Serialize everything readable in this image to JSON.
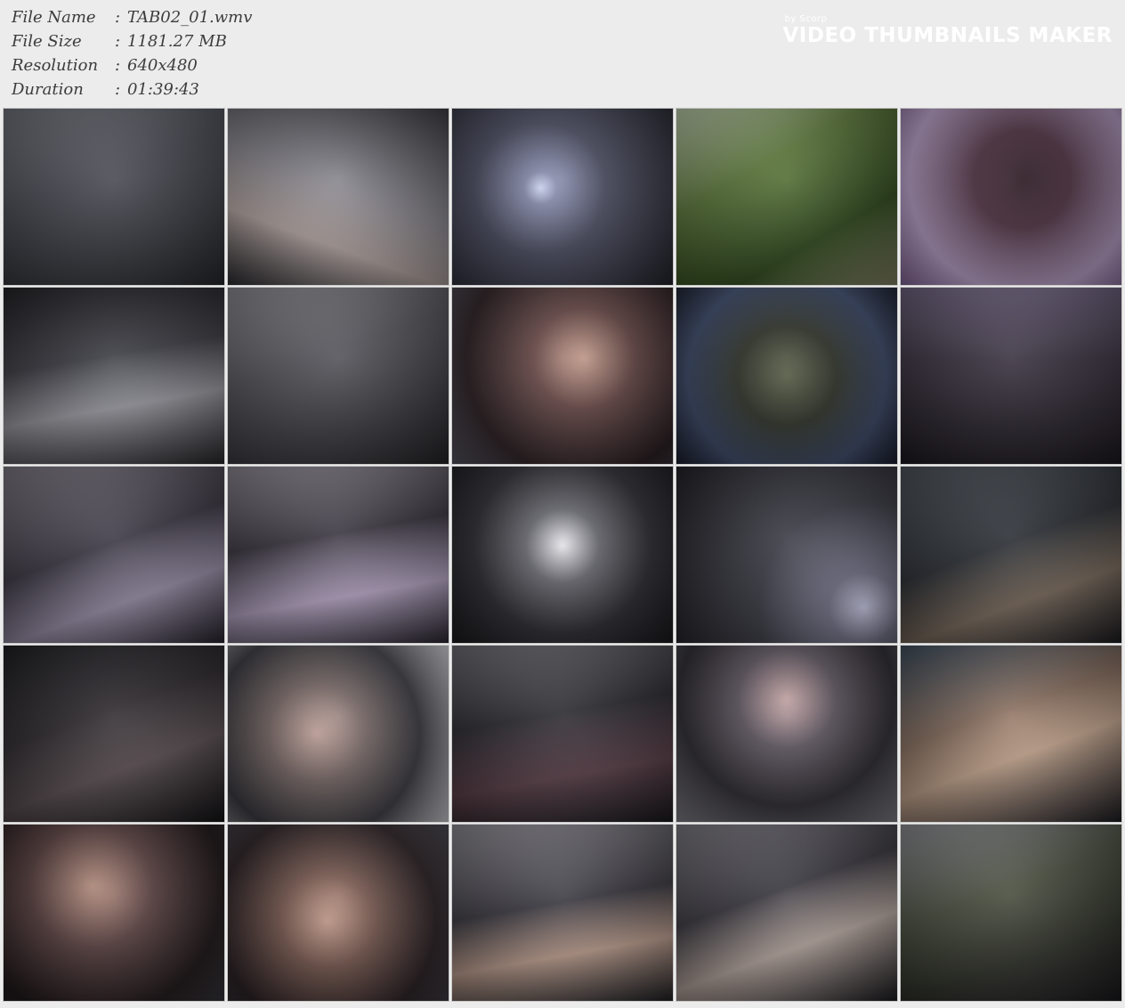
{
  "info": {
    "rows": [
      {
        "label": "File Name",
        "value": "TAB02_01.wmv"
      },
      {
        "label": "File Size",
        "value": "1181.27 MB"
      },
      {
        "label": "Resolution",
        "value": "640x480"
      },
      {
        "label": "Duration",
        "value": "01:39:43"
      }
    ]
  },
  "watermark": {
    "by": "by Scorp",
    "title": "VIDEO THUMBNAILS MAKER"
  },
  "colors": {
    "background": "#ececec",
    "text": "#3c3c3c",
    "watermark": "#ffffff"
  }
}
